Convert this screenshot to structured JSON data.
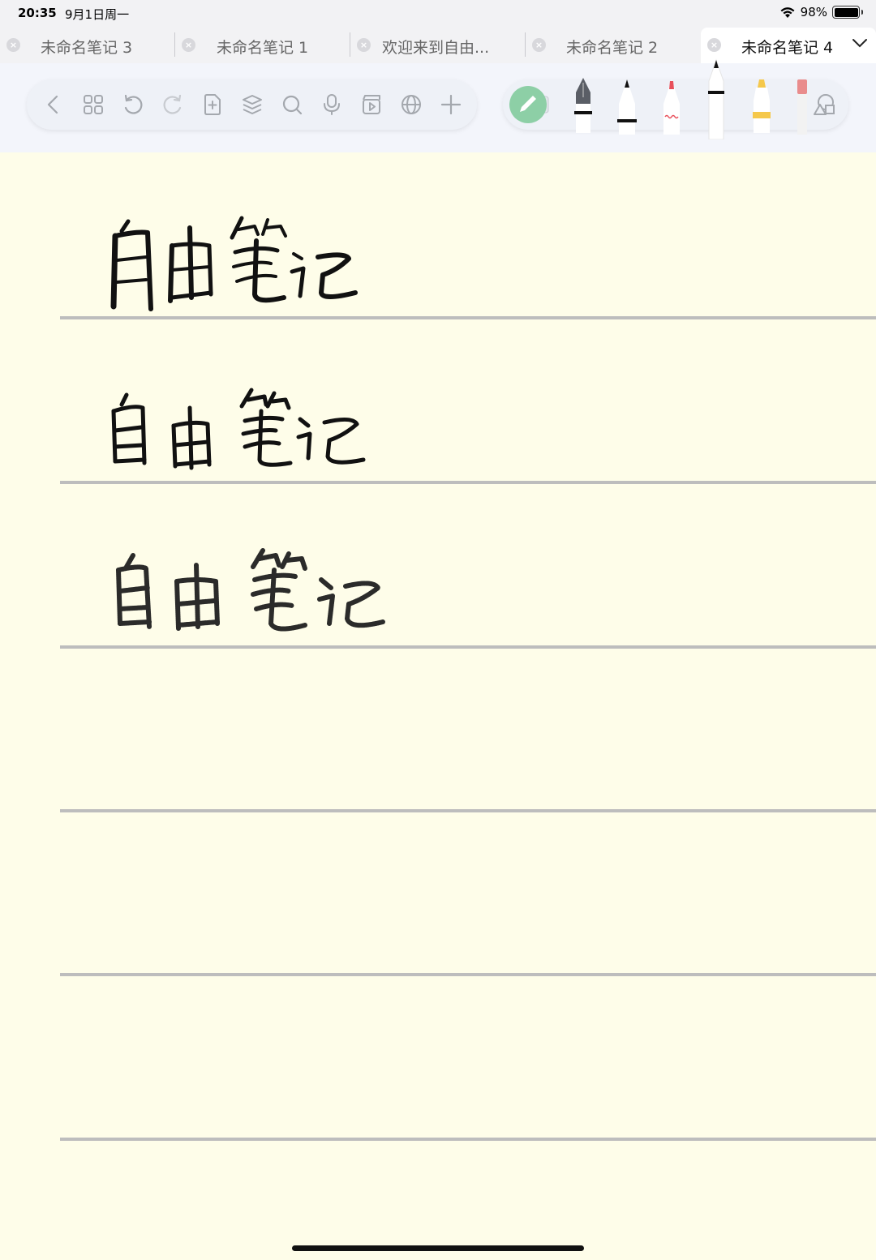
{
  "status_bar": {
    "time": "20:35",
    "date": "9月1日周一",
    "battery": "98%",
    "battery_level": 0.98
  },
  "tabs": [
    {
      "label": "未命名笔记 3",
      "active": false
    },
    {
      "label": "未命名笔记 1",
      "active": false
    },
    {
      "label": "欢迎来到自由...",
      "active": false
    },
    {
      "label": "未命名笔记 2",
      "active": false
    },
    {
      "label": "未命名笔记 4",
      "active": true
    }
  ],
  "toolbar": {
    "icons": [
      "back-icon",
      "grid-icon",
      "undo-icon",
      "redo-icon",
      "add-page-icon",
      "layers-icon",
      "search-icon",
      "microphone-icon",
      "media-icon",
      "globe-icon",
      "plus-icon"
    ]
  },
  "pen_tray": {
    "tools": [
      "pencil-toggle-icon",
      "fountain-pen-icon",
      "ballpoint-pen-icon",
      "red-marker-icon",
      "fineliner-icon",
      "yellow-highlighter-icon",
      "eraser-icon",
      "shapes-icon"
    ],
    "colors": {
      "accent": "#8DCFA6",
      "red": "#E8505B",
      "yellow": "#F5C84B",
      "eraser": "#E98C8C"
    }
  },
  "canvas": {
    "background": "#FEFDE9",
    "handwriting": [
      "自由笔记",
      "自由笔记",
      "自由笔记"
    ]
  }
}
